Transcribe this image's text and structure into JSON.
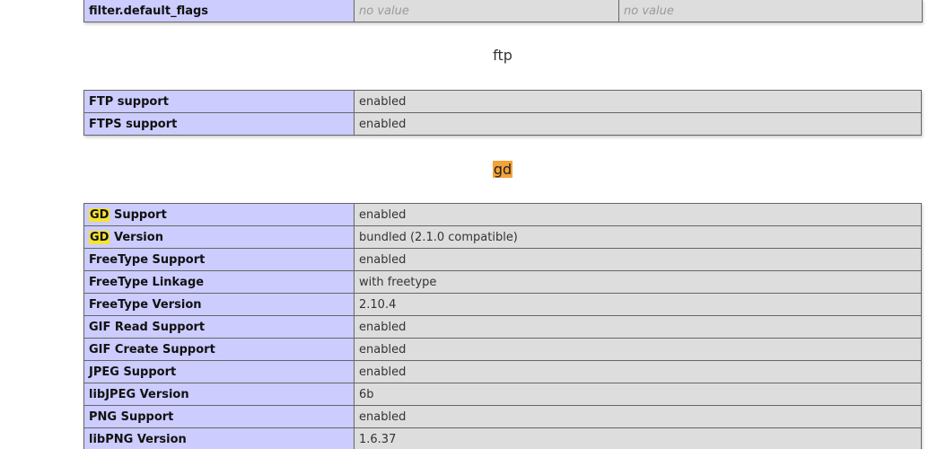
{
  "filter_table": {
    "rows": [
      {
        "key": "filter.default_flags",
        "local": "no value",
        "master": "no value"
      }
    ]
  },
  "sections": {
    "ftp": {
      "title": "ftp",
      "rows": [
        {
          "key": "FTP support",
          "value": "enabled"
        },
        {
          "key": "FTPS support",
          "value": "enabled"
        }
      ]
    },
    "gd": {
      "title": "gd",
      "highlight_term": "GD",
      "rows": [
        {
          "key_hl": "GD",
          "key_rest": " Support",
          "value": "enabled"
        },
        {
          "key_hl": "GD",
          "key_rest": " Version",
          "value": "bundled (2.1.0 compatible)"
        },
        {
          "key": "FreeType Support",
          "value": "enabled"
        },
        {
          "key": "FreeType Linkage",
          "value": "with freetype"
        },
        {
          "key": "FreeType Version",
          "value": "2.10.4"
        },
        {
          "key": "GIF Read Support",
          "value": "enabled"
        },
        {
          "key": "GIF Create Support",
          "value": "enabled"
        },
        {
          "key": "JPEG Support",
          "value": "enabled"
        },
        {
          "key": "libJPEG Version",
          "value": "6b"
        },
        {
          "key": "PNG Support",
          "value": "enabled"
        },
        {
          "key": "libPNG Version",
          "value": "1.6.37"
        }
      ]
    }
  },
  "colors": {
    "key_cell_bg": "#ccccff",
    "value_cell_bg": "#dddddd",
    "search_current_highlight": "#f4a23a",
    "search_match_highlight": "#f5e332"
  }
}
